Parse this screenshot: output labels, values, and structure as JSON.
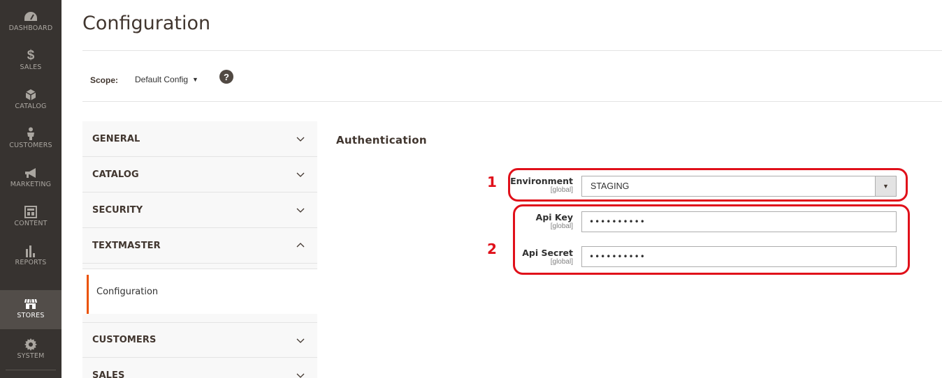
{
  "nav": {
    "items": [
      {
        "label": "DASHBOARD",
        "icon": "dashboard-icon"
      },
      {
        "label": "SALES",
        "icon": "dollar-icon"
      },
      {
        "label": "CATALOG",
        "icon": "cube-icon"
      },
      {
        "label": "CUSTOMERS",
        "icon": "person-icon"
      },
      {
        "label": "MARKETING",
        "icon": "megaphone-icon"
      },
      {
        "label": "CONTENT",
        "icon": "layout-icon"
      },
      {
        "label": "REPORTS",
        "icon": "bar-chart-icon"
      },
      {
        "label": "STORES",
        "icon": "store-icon",
        "active": true
      },
      {
        "label": "SYSTEM",
        "icon": "gear-icon"
      }
    ]
  },
  "page": {
    "title": "Configuration"
  },
  "scope": {
    "label": "Scope:",
    "value": "Default Config",
    "help": "?"
  },
  "tabs": {
    "general": "GENERAL",
    "catalog": "CATALOG",
    "security": "SECURITY",
    "textmaster": "TEXTMASTER",
    "textmaster_sub": "Configuration",
    "customers": "CUSTOMERS",
    "sales": "SALES"
  },
  "section": {
    "title": "Authentication",
    "fields": {
      "environment": {
        "label": "Environment",
        "scope": "[global]",
        "value": "STAGING"
      },
      "api_key": {
        "label": "Api Key",
        "scope": "[global]",
        "value": "••••••••••"
      },
      "api_secret": {
        "label": "Api Secret",
        "scope": "[global]",
        "value": "••••••••••"
      }
    }
  },
  "annotations": {
    "one": "1",
    "two": "2",
    "color": "#e0101a"
  },
  "colors": {
    "nav_bg": "#373330",
    "accent": "#eb5202"
  }
}
